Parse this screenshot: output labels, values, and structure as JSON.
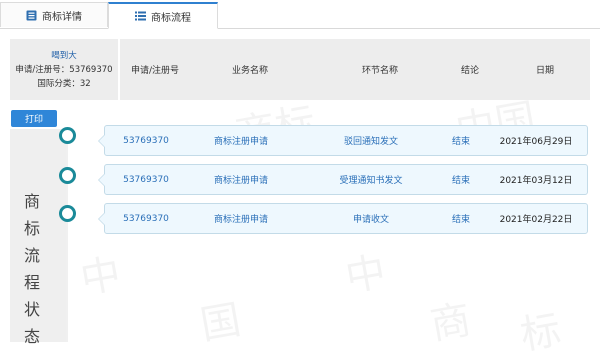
{
  "tabs": [
    {
      "label": "商标详情",
      "icon": "document-list-icon",
      "active": false
    },
    {
      "label": "商标流程",
      "icon": "list-icon",
      "active": true
    }
  ],
  "mark": {
    "name": "喝到大",
    "reg_line": "申请/注册号：53769370",
    "class_line": "国际分类：32"
  },
  "columns": [
    "申请/注册号",
    "业务名称",
    "环节名称",
    "结论",
    "日期"
  ],
  "print_label": "打印",
  "status_title": [
    "商",
    "标",
    "流",
    "程",
    "状",
    "态"
  ],
  "rows": [
    {
      "reg_no": "53769370",
      "business": "商标注册申请",
      "step": "驳回通知发文",
      "result": "结束",
      "date": "2021年06月29日"
    },
    {
      "reg_no": "53769370",
      "business": "商标注册申请",
      "step": "受理通知书发文",
      "result": "结束",
      "date": "2021年03月12日"
    },
    {
      "reg_no": "53769370",
      "business": "商标注册申请",
      "step": "申请收文",
      "result": "结束",
      "date": "2021年02月22日"
    }
  ],
  "colors": {
    "accent": "#2f86d8",
    "link": "#2a6fb8",
    "node": "#1a8a99",
    "card_bg": "#eef8fe"
  }
}
